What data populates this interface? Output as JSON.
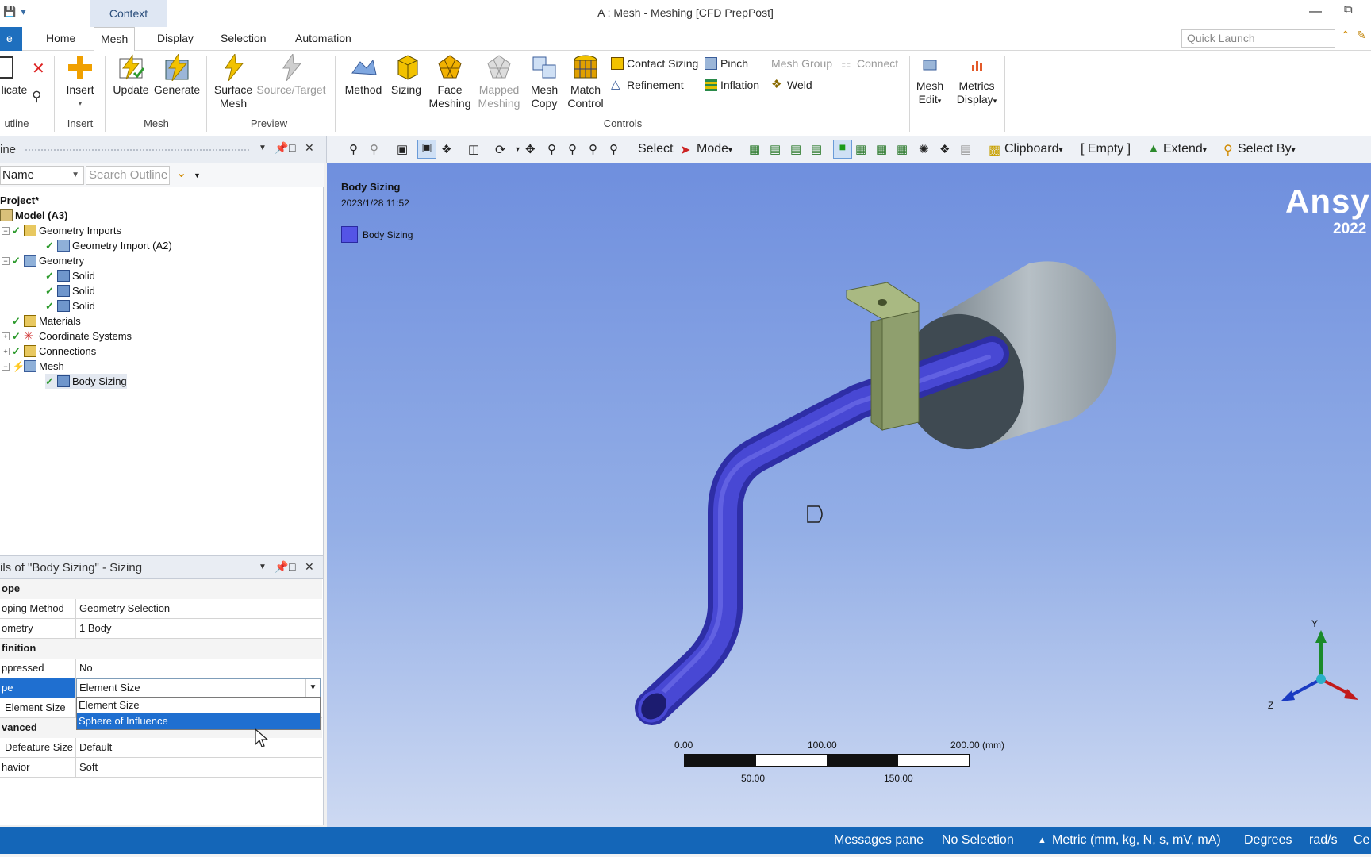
{
  "window": {
    "title": "A : Mesh - Meshing [CFD PrepPost]",
    "context_tab": "Context"
  },
  "tabs": {
    "file": "e",
    "items": [
      "Home",
      "Mesh",
      "Display",
      "Selection",
      "Automation"
    ],
    "active": "Mesh",
    "quick_launch_placeholder": "Quick Launch"
  },
  "ribbon": {
    "outline_group": {
      "duplicate": "licate",
      "label": "utline"
    },
    "insert_group": {
      "insert": "Insert",
      "label": "Insert"
    },
    "mesh_group": {
      "update": "Update",
      "generate": "Generate",
      "label": "Mesh"
    },
    "preview_group": {
      "surface_mesh": [
        "Surface",
        "Mesh"
      ],
      "source_target": "Source/Target",
      "label": "Preview"
    },
    "controls_group": {
      "method": "Method",
      "sizing": "Sizing",
      "face_meshing": [
        "Face",
        "Meshing"
      ],
      "mapped_meshing": [
        "Mapped",
        "Meshing"
      ],
      "mesh_copy": [
        "Mesh",
        "Copy"
      ],
      "match_control": [
        "Match",
        "Control"
      ],
      "contact_sizing": "Contact Sizing",
      "refinement": "Refinement",
      "pinch": "Pinch",
      "inflation": "Inflation",
      "mesh_group_btn": "Mesh Group",
      "weld": "Weld",
      "connect": "Connect",
      "label": "Controls"
    },
    "mesh_edit": [
      "Mesh",
      "Edit"
    ],
    "metrics_display": [
      "Metrics",
      "Display"
    ]
  },
  "toolbar": {
    "select": "Select",
    "mode": "Mode",
    "clipboard": "Clipboard",
    "empty": "[ Empty ]",
    "extend": "Extend",
    "select_by": "Select By"
  },
  "outline": {
    "title": "ine",
    "filter_select": "Name",
    "search_placeholder": "Search Outline",
    "tree": {
      "project": "Project*",
      "model": "Model (A3)",
      "geometry_imports": "Geometry Imports",
      "geometry_import_a2": "Geometry Import (A2)",
      "geometry": "Geometry",
      "solid": "Solid",
      "materials": "Materials",
      "coordinate_systems": "Coordinate Systems",
      "connections": "Connections",
      "mesh": "Mesh",
      "body_sizing": "Body Sizing"
    }
  },
  "details": {
    "title": "ils of \"Body Sizing\" - Sizing",
    "rows": {
      "scope_header": "ope",
      "scoping_method_k": "oping Method",
      "scoping_method_v": "Geometry Selection",
      "geometry_k": "ometry",
      "geometry_v": "1 Body",
      "definition_header": "finition",
      "suppressed_k": "ppressed",
      "suppressed_v": "No",
      "type_k": "pe",
      "type_v": "Element Size",
      "element_size_k": "Element Size",
      "advanced_header": "vanced",
      "defeature_k": "Defeature Size",
      "defeature_v": "Default",
      "behavior_k": "havior",
      "behavior_v": "Soft"
    },
    "dropdown": [
      "Element Size",
      "Sphere of Influence"
    ],
    "dropdown_selected": "Sphere of Influence"
  },
  "viewport": {
    "object_title": "Body Sizing",
    "timestamp": "2023/1/28 11:52",
    "legend": "Body Sizing",
    "legend_color": "#5454e6",
    "brand": "Ansy",
    "brand_year": "2022",
    "scale": {
      "top": [
        "0.00",
        "100.00",
        "200.00 (mm)"
      ],
      "bottom": [
        "50.00",
        "150.00"
      ]
    },
    "triad": {
      "y": "Y",
      "z": "Z"
    }
  },
  "status": {
    "messages": "Messages pane",
    "selection": "No Selection",
    "units": "Metric (mm, kg, N, s, mV, mA)",
    "angle": "Degrees",
    "rate": "rad/s",
    "temp": "Ce"
  },
  "colors": {
    "accent": "#1466b8",
    "pipe": "#3b3bc4",
    "bracket": "#8f9f6e",
    "cylinder": "#9aa6ad"
  }
}
